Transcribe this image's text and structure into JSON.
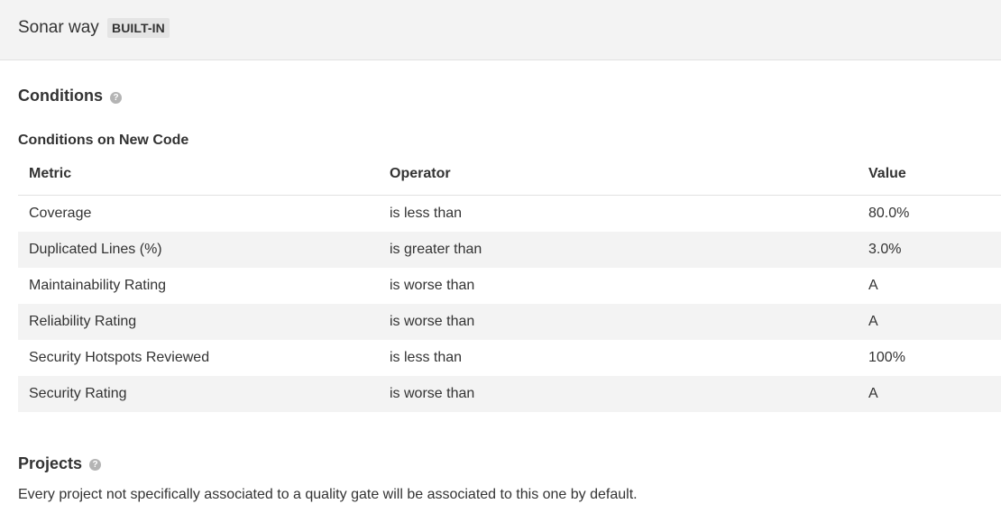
{
  "header": {
    "title": "Sonar way",
    "badge": "BUILT-IN"
  },
  "conditions": {
    "title": "Conditions",
    "help_icon": "question-circle-icon",
    "subtitle": "Conditions on New Code",
    "columns": {
      "metric": "Metric",
      "operator": "Operator",
      "value": "Value"
    },
    "rows": [
      {
        "metric": "Coverage",
        "operator": "is less than",
        "value": "80.0%"
      },
      {
        "metric": "Duplicated Lines (%)",
        "operator": "is greater than",
        "value": "3.0%"
      },
      {
        "metric": "Maintainability Rating",
        "operator": "is worse than",
        "value": "A"
      },
      {
        "metric": "Reliability Rating",
        "operator": "is worse than",
        "value": "A"
      },
      {
        "metric": "Security Hotspots Reviewed",
        "operator": "is less than",
        "value": "100%"
      },
      {
        "metric": "Security Rating",
        "operator": "is worse than",
        "value": "A"
      }
    ]
  },
  "projects": {
    "title": "Projects",
    "help_icon": "question-circle-icon",
    "description": "Every project not specifically associated to a quality gate will be associated to this one by default."
  },
  "colors": {
    "header_bg": "#f3f3f3",
    "row_alt_bg": "#f3f3f3",
    "badge_bg": "#e4e4e4",
    "text": "#333333",
    "help_icon": "#b4b4b4"
  }
}
